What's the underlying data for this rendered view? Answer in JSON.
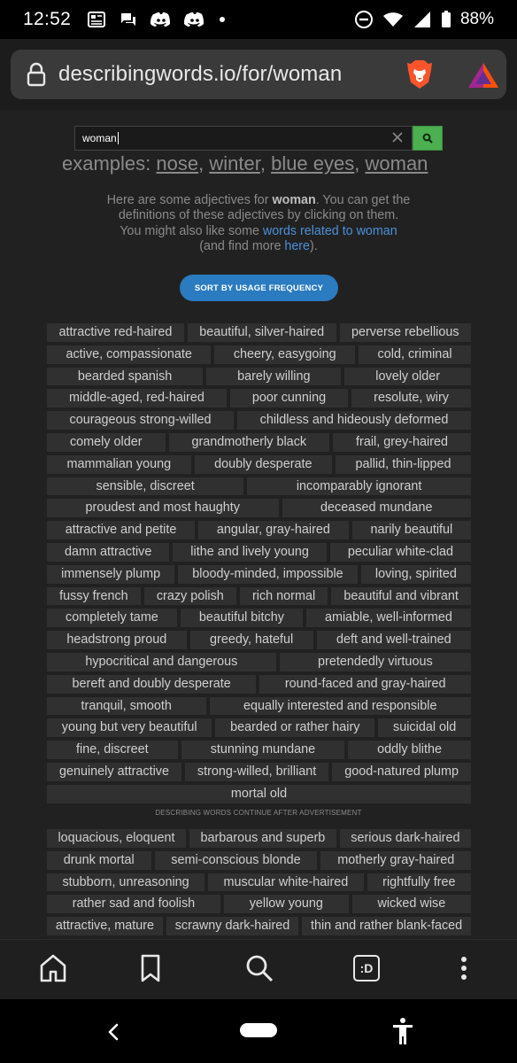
{
  "status_bar": {
    "time": "12:52",
    "battery": "88%"
  },
  "browser": {
    "url": "describingwords.io/for/woman"
  },
  "search": {
    "value": "woman"
  },
  "examples": {
    "label": "examples:",
    "items": [
      "nose",
      "winter",
      "blue eyes",
      "woman"
    ]
  },
  "intro": {
    "p1": "Here are some adjectives for ",
    "term": "woman",
    "p2": ". You can get the definitions of these adjectives by clicking on them. You might also like some ",
    "link1": "words related to woman",
    "p3": " (and find more ",
    "link2": "here",
    "p4": ")."
  },
  "sort_button": "SORT BY USAGE FREQUENCY",
  "ad_note": "DESCRIBING WORDS CONTINUE AFTER ADVERTISEMENT",
  "word_rows": [
    [
      "attractive red-haired",
      "beautiful, silver-haired",
      "perverse rebellious"
    ],
    [
      "active, compassionate",
      "cheery, easygoing",
      "cold, criminal"
    ],
    [
      "bearded spanish",
      "barely willing",
      "lovely older"
    ],
    [
      "middle-aged, red-haired",
      "poor cunning",
      "resolute, wiry"
    ],
    [
      "courageous strong-willed",
      "childless and hideously deformed"
    ],
    [
      "comely older",
      "grandmotherly black",
      "frail, grey-haired"
    ],
    [
      "mammalian young",
      "doubly desperate",
      "pallid, thin-lipped"
    ],
    [
      "sensible, discreet",
      "incomparably ignorant"
    ],
    [
      "proudest and most haughty",
      "deceased mundane"
    ],
    [
      "attractive and petite",
      "angular, gray-haired",
      "narily beautiful"
    ],
    [
      "damn attractive",
      "lithe and lively young",
      "peculiar white-clad"
    ],
    [
      "immensely plump",
      "bloody-minded, impossible",
      "loving, spirited"
    ],
    [
      "fussy french",
      "crazy polish",
      "rich normal",
      "beautiful and vibrant"
    ],
    [
      "completely tame",
      "beautiful bitchy",
      "amiable, well-informed"
    ],
    [
      "headstrong proud",
      "greedy, hateful",
      "deft and well-trained"
    ],
    [
      "hypocritical and dangerous",
      "pretendedly virtuous"
    ],
    [
      "bereft and doubly desperate",
      "round-faced and gray-haired"
    ],
    [
      "tranquil, smooth",
      "equally interested and responsible"
    ],
    [
      "young but very beautiful",
      "bearded or rather hairy",
      "suicidal old"
    ],
    [
      "fine, discreet",
      "stunning mundane",
      "oddly blithe"
    ],
    [
      "genuinely attractive",
      "strong-willed, brilliant",
      "good-natured plump"
    ],
    [
      "mortal old"
    ]
  ],
  "word_rows2": [
    [
      "loquacious, eloquent",
      "barbarous and superb",
      "serious dark-haired"
    ],
    [
      "drunk mortal",
      "semi-conscious blonde",
      "motherly gray-haired"
    ],
    [
      "stubborn, unreasoning",
      "muscular white-haired",
      "rightfully free"
    ],
    [
      "rather sad and foolish",
      "yellow young",
      "wicked wise"
    ],
    [
      "attractive, mature",
      "scrawny dark-haired",
      "thin and rather blank-faced"
    ]
  ],
  "bottom_toolbar": {
    "tabs_label": ":D"
  }
}
